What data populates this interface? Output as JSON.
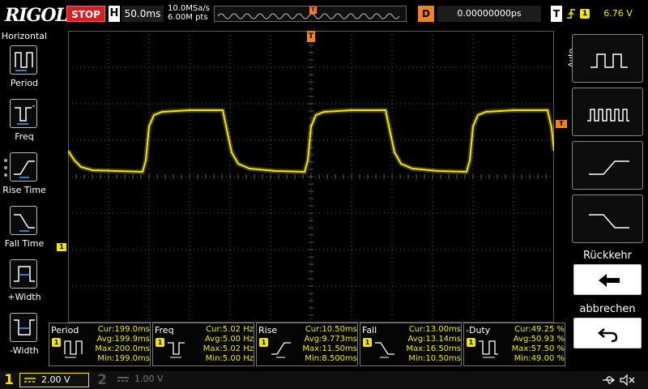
{
  "top": {
    "logo": "RIGOL",
    "run_state": "STOP",
    "horizontal_label": "H",
    "timebase": "50.0ms",
    "sample_rate": "10.0MSa/s",
    "memory_depth": "6.00M pts",
    "trigger_marker": "T",
    "delay_label": "D",
    "delay_value": "0.00000000ps",
    "trigger_label": "T",
    "trigger_channel": "1",
    "trigger_level": "6.76 V"
  },
  "left_menu": {
    "title": "Horizontal",
    "items": [
      {
        "label": "Period",
        "icon": "period-icon"
      },
      {
        "label": "Freq",
        "icon": "freq-icon"
      },
      {
        "label": "Rise Time",
        "icon": "rise-time-icon"
      },
      {
        "label": "Fall Time",
        "icon": "fall-time-icon"
      },
      {
        "label": "+Width",
        "icon": "pos-width-icon"
      },
      {
        "label": "-Width",
        "icon": "neg-width-icon"
      }
    ]
  },
  "screen": {
    "ch1_marker": "1",
    "trigger_position_marker": "T",
    "trigger_level_marker": "T"
  },
  "measurements": [
    {
      "name": "Period",
      "channel": "1",
      "cur": "Cur:199.0ms",
      "avg": "Avg:199.9ms",
      "max": "Max:200.0ms",
      "min": "Min:199.0ms"
    },
    {
      "name": "Freq",
      "channel": "1",
      "cur": "Cur:5.02 Hz",
      "avg": "Avg:5.00 Hz",
      "max": "Max:5.02 Hz",
      "min": "Min:5.00 Hz"
    },
    {
      "name": "Rise",
      "channel": "1",
      "cur": "Cur:10.50ms",
      "avg": "Avg:9.773ms",
      "max": "Max:11.50ms",
      "min": "Min:8.500ms"
    },
    {
      "name": "Fall",
      "channel": "1",
      "cur": "Cur:13.00ms",
      "avg": "Avg:13.14ms",
      "max": "Max:16.50ms",
      "min": "Min:10.50ms"
    },
    {
      "name": "-Duty",
      "channel": "1",
      "cur": "Cur:49.25 %",
      "avg": "Avg:50.93 %",
      "max": "Max:57.50 %",
      "min": "Min:49.00 %"
    }
  ],
  "right_menu": {
    "auto_label": "Auto",
    "back_label": "Rückkehr",
    "cancel_label": "abbrechen"
  },
  "bottom": {
    "ch1_number": "1",
    "ch1_coupling": "",
    "ch1_scale": "2.00 V",
    "ch2_number": "2",
    "ch2_coupling": "",
    "ch2_scale": "1.00 V"
  },
  "colors": {
    "ch1": "#f2e600",
    "trigger": "#f08020",
    "stop": "#d42020",
    "grid": "#5a5a5a"
  }
}
